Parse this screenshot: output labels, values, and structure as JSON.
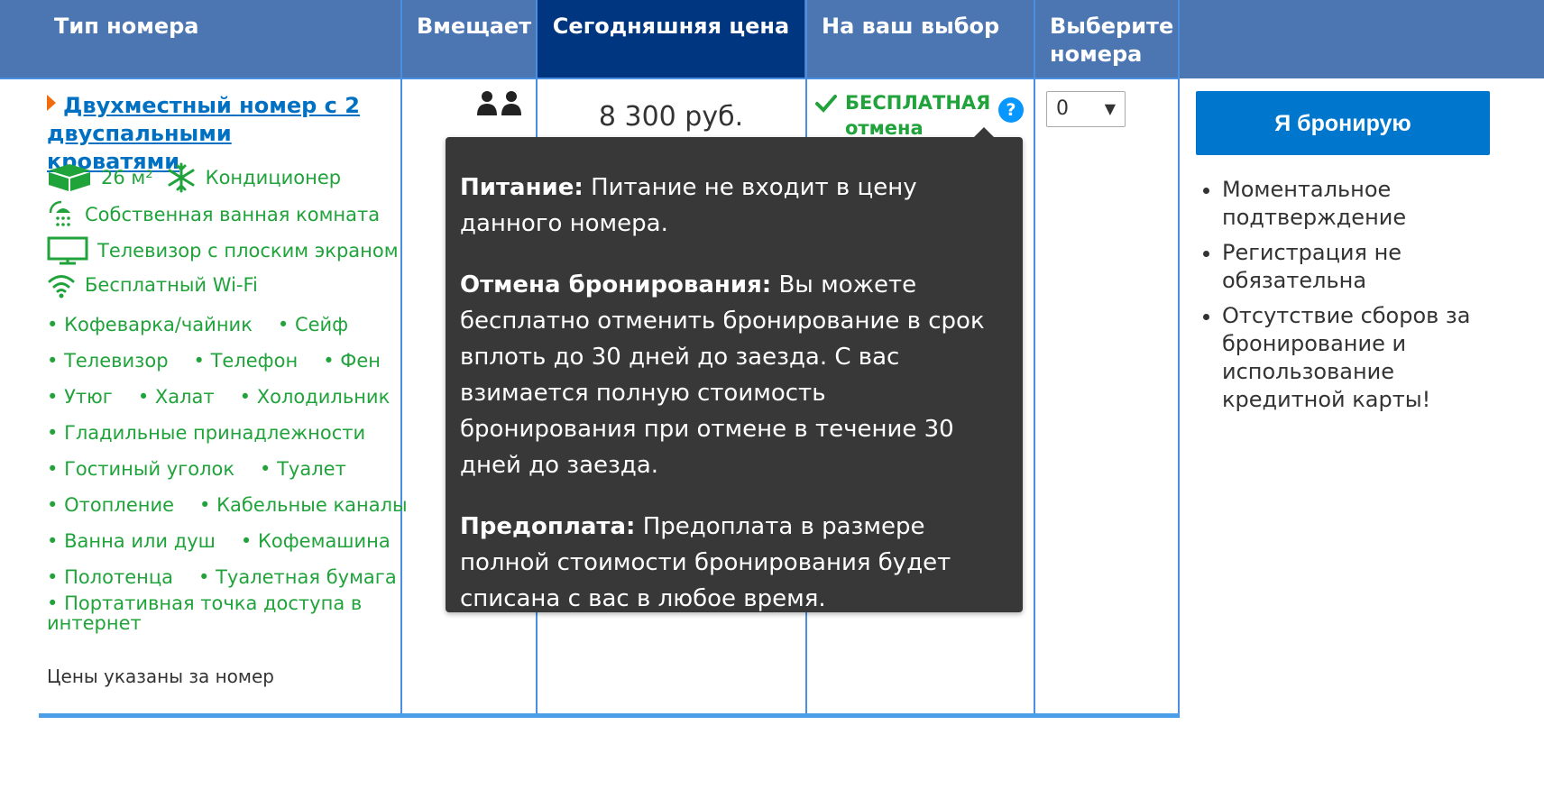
{
  "header": {
    "room_type": "Тип номера",
    "capacity": "Вмещает",
    "price_today": "Сегодняшняя цена",
    "your_choice": "На ваш выбор",
    "select_rooms": "Выберите номера"
  },
  "room": {
    "name": "Двухместный номер с 2 двуспальными кроватями",
    "area": "26 м²",
    "ac": "Кондиционер",
    "bathroom": "Собственная ванная комната",
    "tv": "Телевизор с плоским экраном",
    "wifi": "Бесплатный Wi-Fi",
    "amenity_rows": [
      [
        "Кофеварка/чайник",
        "Сейф"
      ],
      [
        "Телевизор",
        "Телефон",
        "Фен"
      ],
      [
        "Утюг",
        "Халат",
        "Холодильник"
      ],
      [
        "Гладильные принадлежности"
      ],
      [
        "Гостиный уголок",
        "Туалет"
      ],
      [
        "Отопление",
        "Кабельные каналы"
      ],
      [
        "Ванна или душ",
        "Кофемашина"
      ],
      [
        "Полотенца",
        "Туалетная бумага"
      ]
    ],
    "last_amenity": "Портативная точка доступа в интернет",
    "price_note": "Цены указаны за номер",
    "price": "8 300 руб.",
    "free_cancel": "БЕСПЛАТНАЯ отмена",
    "qmark": "?",
    "quantity": "0",
    "select_arrow": "▼"
  },
  "booking": {
    "button": "Я бронирую",
    "benefits": [
      "Моментальное подтверждение",
      "Регистрация не обязательна",
      "Отсутствие сборов за бронирование и использование кредитной карты!"
    ]
  },
  "tooltip": {
    "meals_label": "Питание:",
    "meals_text": "Питание не входит в цену данного номера.",
    "cancel_label": "Отмена бронирования:",
    "cancel_text": "Вы можете бесплатно отменить бронирование в срок вплоть до 30 дней до заезда. С вас взимается полную стоимость бронирования при отмене в течение 30 дней до заезда.",
    "prepay_label": "Предоплата:",
    "prepay_text": "Предоплата в размере полной стоимости бронирования будет списана с вас в любое время."
  },
  "colors": {
    "header_bg": "#4c76b2",
    "header_selected_bg": "#003580",
    "facility_green": "#21a33c",
    "link_blue": "#0071c2",
    "button_blue": "#0077cc",
    "tooltip_bg": "#383838"
  }
}
